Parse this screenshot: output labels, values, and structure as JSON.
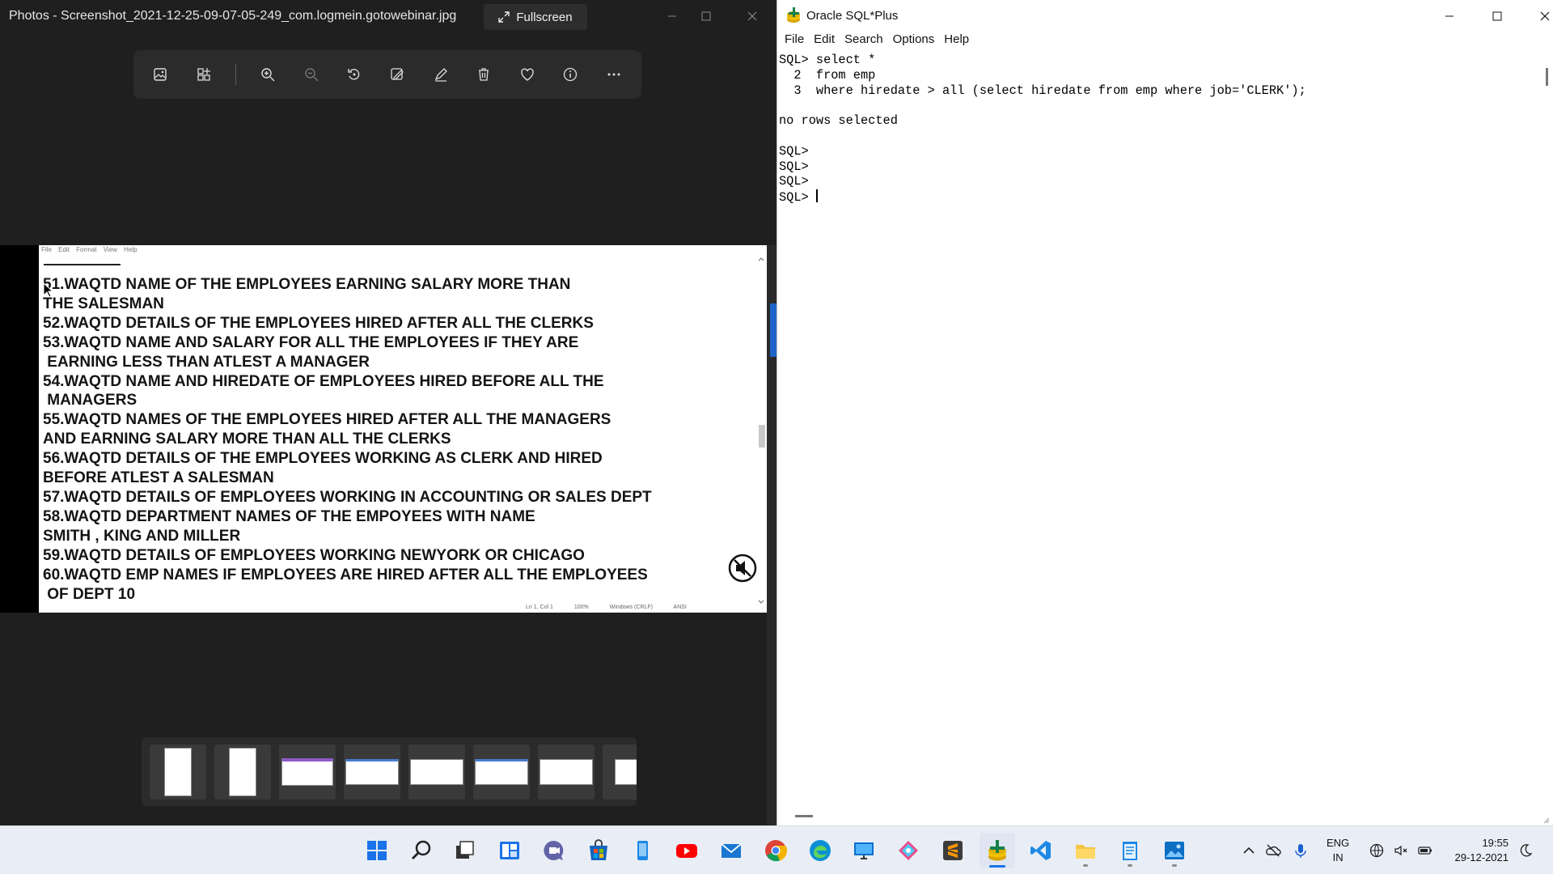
{
  "photos": {
    "title": "Photos - Screenshot_2021-12-25-09-07-05-249_com.logmein.gotowebinar.jpg",
    "fullscreen_label": "Fullscreen",
    "toolbar": [
      "view-image-icon",
      "gallery-icon",
      "zoom-in-icon",
      "zoom-out-icon",
      "rotate-icon",
      "edit-image-icon",
      "draw-icon",
      "delete-icon",
      "favorite-icon",
      "info-icon",
      "more-icon"
    ],
    "document": {
      "menu": [
        "File",
        "Edit",
        "Format",
        "View",
        "Help"
      ],
      "lines": [
        "51.WAQTD NAME OF THE EMPLOYEES EARNING SALARY MORE THAN",
        "THE SALESMAN",
        "52.WAQTD DETAILS OF THE EMPLOYEES HIRED AFTER ALL THE CLERKS",
        "53.WAQTD NAME AND SALARY FOR ALL THE EMPLOYEES IF THEY ARE",
        " EARNING LESS THAN ATLEST A MANAGER",
        "54.WAQTD NAME AND HIREDATE OF EMPLOYEES HIRED BEFORE ALL THE",
        " MANAGERS",
        "55.WAQTD NAMES OF THE EMPLOYEES HIRED AFTER ALL THE MANAGERS",
        "AND EARNING SALARY MORE THAN ALL THE CLERKS",
        "56.WAQTD DETAILS OF THE EMPLOYEES WORKING AS CLERK AND HIRED",
        "BEFORE ATLEST A SALESMAN",
        "57.WAQTD DETAILS OF EMPLOYEES WORKING IN ACCOUNTING OR SALES DEPT",
        "58.WAQTD DEPARTMENT NAMES OF THE EMPOYEES WITH NAME",
        "SMITH , KING AND MILLER",
        "59.WAQTD DETAILS OF EMPLOYEES WORKING NEWYORK OR CHICAGO",
        "60.WAQTD EMP NAMES IF EMPLOYEES ARE HIRED AFTER ALL THE EMPLOYEES",
        " OF DEPT 10"
      ],
      "status": [
        "Ln 1, Col 1",
        "100%",
        "Windows (CRLF)",
        "ANSI"
      ]
    },
    "filmstrip_count": 8
  },
  "sqlplus": {
    "title": "Oracle SQL*Plus",
    "menu": [
      "File",
      "Edit",
      "Search",
      "Options",
      "Help"
    ],
    "console_lines": [
      "SQL> select *",
      "  2  from emp",
      "  3  where hiredate > all (select hiredate from emp where job='CLERK');",
      "",
      "no rows selected",
      "",
      "SQL>",
      "SQL>",
      "SQL>"
    ],
    "prompt": "SQL> "
  },
  "taskbar": {
    "apps": [
      "start-icon",
      "search-icon",
      "task-view-icon",
      "widgets-icon",
      "teams-chat-icon",
      "store-icon",
      "phone-link-icon",
      "youtube-icon",
      "mail-icon",
      "chrome-icon",
      "edge-icon",
      "remote-desktop-icon",
      "snip-icon",
      "sublime-text-icon",
      "sqlplus-icon",
      "vscode-icon",
      "file-explorer-icon",
      "notepad-icon",
      "photos-icon"
    ],
    "lang_line1": "ENG",
    "lang_line2": "IN",
    "time": "19:55",
    "date": "29-12-2021"
  },
  "colors": {
    "accent": "#1a73e8",
    "photos_bg": "#1f1f1f",
    "taskbar_bg": "#e9eef6"
  }
}
